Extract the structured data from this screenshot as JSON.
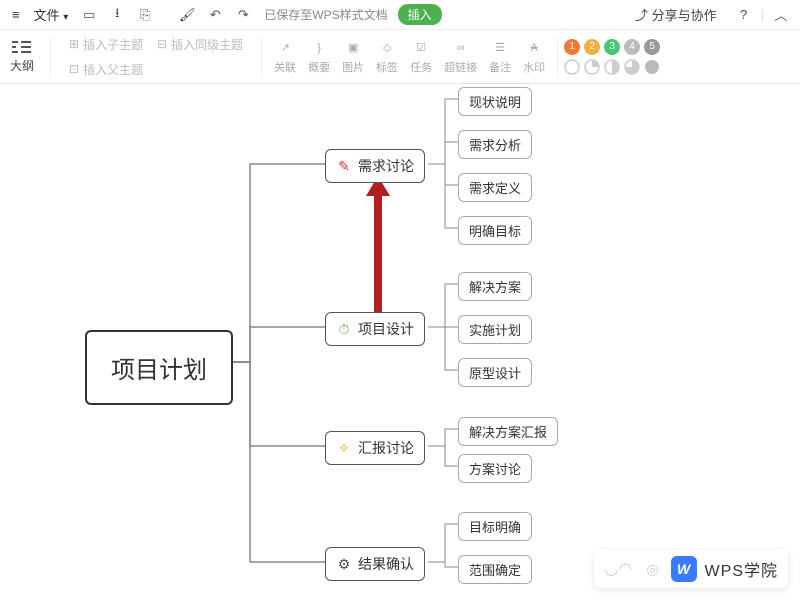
{
  "toolbar1": {
    "file_menu": "文件",
    "saved_text": "已保存至WPS样式文档",
    "style_label": "样式",
    "insert_chip": "插入",
    "share": "分享与协作"
  },
  "toolbar2": {
    "outline": "大纲",
    "insert_child": "插入子主题",
    "insert_sibling": "插入同级主题",
    "insert_parent": "插入父主题",
    "relation": "关联",
    "summary": "概要",
    "image": "图片",
    "tag": "标签",
    "task": "任务",
    "hyperlink": "超链接",
    "note": "备注",
    "watermark": "水印",
    "priority": [
      "1",
      "2",
      "3",
      "4",
      "5"
    ]
  },
  "mindmap": {
    "root": "项目计划",
    "branches": [
      {
        "label": "需求讨论",
        "icon": "pencil",
        "color": "#cc3333",
        "children": [
          "现状说明",
          "需求分析",
          "需求定义",
          "明确目标"
        ]
      },
      {
        "label": "项目设计",
        "icon": "stopwatch",
        "color": "#6ab04c",
        "children": [
          "解决方案",
          "实施计划",
          "原型设计"
        ]
      },
      {
        "label": "汇报讨论",
        "icon": "lightbulb",
        "color": "#f0a020",
        "children": [
          "解决方案汇报",
          "方案讨论"
        ]
      },
      {
        "label": "结果确认",
        "icon": "gear",
        "color": "#444",
        "children": [
          "目标明确",
          "范围确定"
        ]
      }
    ]
  },
  "watermark_bar": {
    "logo": "W",
    "text": "WPS学院"
  }
}
